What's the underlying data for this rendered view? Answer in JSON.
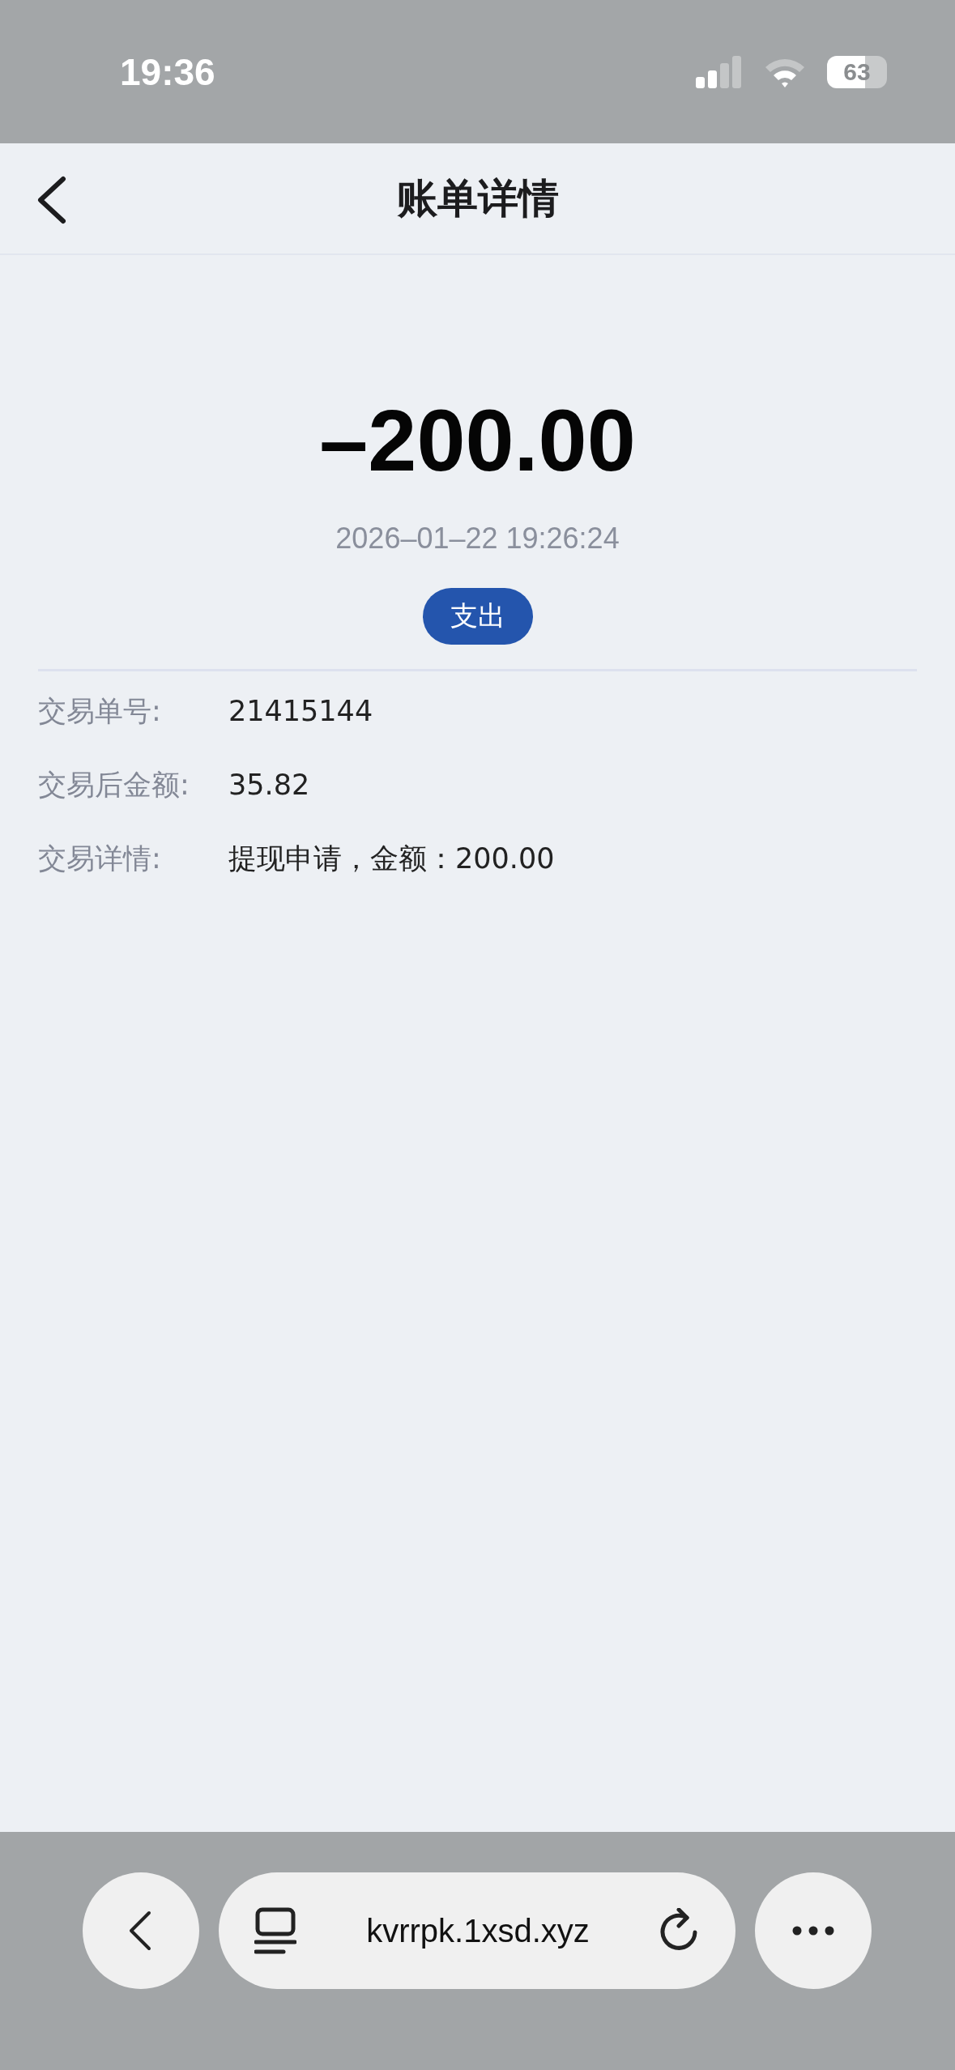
{
  "status_bar": {
    "time": "19:36",
    "battery": "63"
  },
  "header": {
    "title": "账单详情"
  },
  "bill": {
    "amount": "–200.00",
    "datetime": "2026–01–22 19:26:24",
    "type_badge": "支出"
  },
  "details": [
    {
      "label": "交易单号:",
      "value": "21415144"
    },
    {
      "label": "交易后金额:",
      "value": "35.82"
    },
    {
      "label": "交易详情:",
      "value": "提现申请，金额：200.00"
    }
  ],
  "browser_bar": {
    "url": "kvrrpk.1xsd.xyz"
  }
}
